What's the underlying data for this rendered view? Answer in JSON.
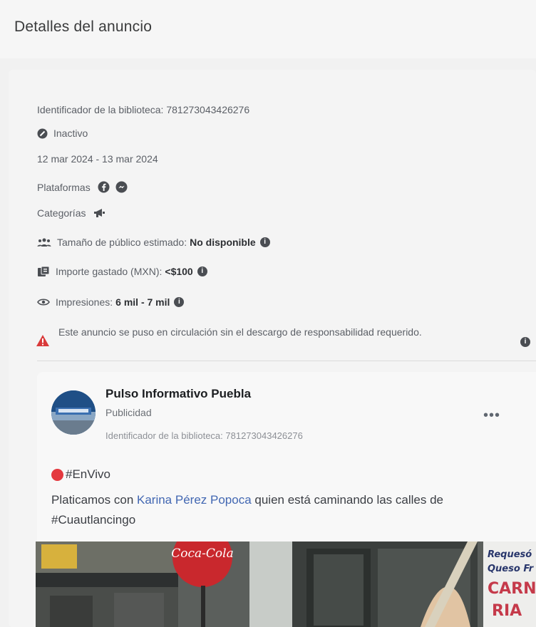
{
  "header": {
    "title": "Detalles del anuncio"
  },
  "details": {
    "library_id": "Identificador de la biblioteca: 781273043426276",
    "status": "Inactivo",
    "dates": "12 mar 2024 - 13 mar 2024",
    "platforms_label": "Plataformas",
    "categories_label": "Categorías",
    "audience_label": "Tamaño de público estimado:",
    "audience_value": "No disponible",
    "spend_label": "Importe gastado (MXN):",
    "spend_value": "<$100",
    "impressions_label": "Impresiones:",
    "impressions_value": "6 mil - 7 mil",
    "warning": "Este anuncio se puso en circulación sin el descargo de responsabilidad requerido."
  },
  "post": {
    "page_name": "Pulso Informativo Puebla",
    "sponsored": "Publicidad",
    "library_id": "Identificador de la biblioteca: 781273043426276",
    "more": "•••",
    "live_tag": "#EnVivo",
    "text_before": "Platicamos con ",
    "mention": "Karina Pérez Popoca",
    "text_after": " quien está caminando las calles de #Cuautlancingo"
  },
  "image_signs": {
    "cocacola": "Coca-Cola",
    "sign_line1": "Requesó",
    "sign_line2": "Queso Fr",
    "sign_line3": "CARN",
    "sign_line4": "RIA"
  },
  "colors": {
    "accent_link": "#4267b2",
    "warning": "#d93a3a",
    "live": "#e4393f"
  },
  "icons": [
    "inactive-icon",
    "facebook-icon",
    "messenger-icon",
    "megaphone-icon",
    "audience-icon",
    "money-icon",
    "eye-icon",
    "info-icon",
    "warning-icon"
  ]
}
